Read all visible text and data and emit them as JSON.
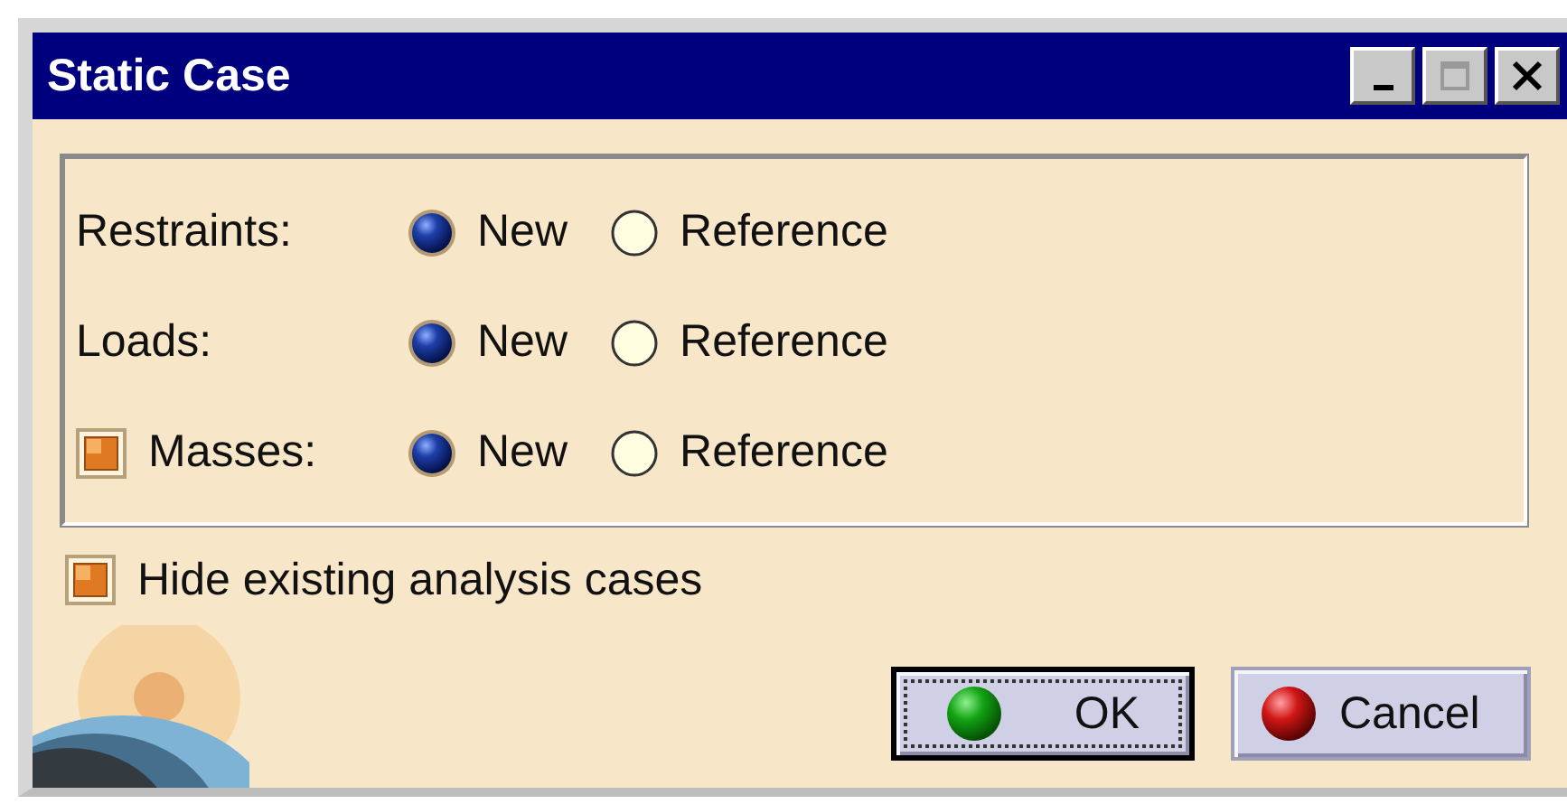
{
  "window": {
    "title": "Static Case",
    "controls": [
      {
        "kind": "minimize",
        "disabled": false
      },
      {
        "kind": "maximize",
        "disabled": true
      },
      {
        "kind": "close",
        "disabled": false
      }
    ]
  },
  "groups": [
    {
      "label": "Restraints:",
      "kind": "plain",
      "options": [
        {
          "label": "New",
          "selected": true
        },
        {
          "label": "Reference",
          "selected": false
        }
      ]
    },
    {
      "label": "Loads:",
      "kind": "plain",
      "options": [
        {
          "label": "New",
          "selected": true
        },
        {
          "label": "Reference",
          "selected": false
        }
      ]
    },
    {
      "label": "Masses:",
      "kind": "checkbox",
      "checked": true,
      "options": [
        {
          "label": "New",
          "selected": true
        },
        {
          "label": "Reference",
          "selected": false
        }
      ]
    }
  ],
  "hide_existing": {
    "label": "Hide existing analysis cases",
    "checked": true
  },
  "buttons": [
    {
      "label": "OK",
      "kind": "ok",
      "focused": true
    },
    {
      "label": "Cancel",
      "kind": "cancel",
      "focused": false
    }
  ]
}
